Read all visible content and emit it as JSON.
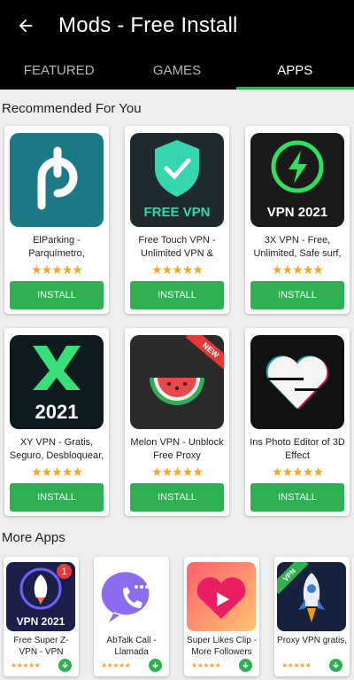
{
  "appbar": {
    "title": "Mods - Free Install",
    "back_icon": "arrow-left-icon"
  },
  "tabs": [
    {
      "label": "FEATURED",
      "active": false
    },
    {
      "label": "GAMES",
      "active": false
    },
    {
      "label": "APPS",
      "active": true
    }
  ],
  "recommended": {
    "title": "Recommended For You",
    "install_label": "INSTALL",
    "stars": "★★★★★",
    "apps": [
      {
        "name": "ElParking - Parquímetro,",
        "icon_text": ""
      },
      {
        "name": "Free Touch VPN - Unlimited VPN &",
        "icon_text": "FREE VPN"
      },
      {
        "name": "3X VPN - Free, Unlimited, Safe surf,",
        "icon_text": "VPN 2021"
      },
      {
        "name": "XY VPN - Gratis, Seguro, Desbloquear,",
        "icon_text": "2021"
      },
      {
        "name": "Melon VPN - Unblock Free Proxy",
        "icon_text": "NEW"
      },
      {
        "name": "Ins Photo Editor of 3D Effect",
        "icon_text": ""
      }
    ]
  },
  "more": {
    "title": "More Apps",
    "stars": "★★★★★",
    "apps": [
      {
        "name": "Free Super Z-VPN - VPN",
        "icon_text": "VPN 2021",
        "badge": "1"
      },
      {
        "name": "AbTalk Call - Llamada",
        "icon_text": ""
      },
      {
        "name": "Super Likes Clip - More Followers",
        "icon_text": ""
      },
      {
        "name": "Proxy VPN gratis,",
        "icon_text": "VPN"
      }
    ]
  },
  "colors": {
    "accent": "#2fb052",
    "star": "#f5a623",
    "appbar": "#000000"
  }
}
